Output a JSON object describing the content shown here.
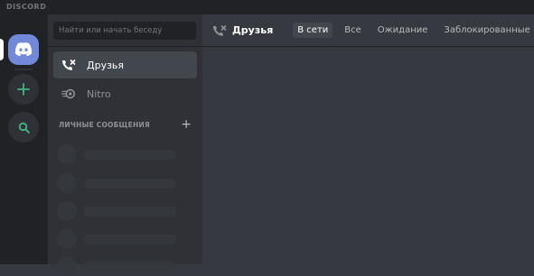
{
  "app": {
    "brand": "DISCORD"
  },
  "guilds": {
    "home_icon": "discord-logo-icon",
    "add_icon": "plus-icon",
    "search_icon": "magnifier-icon"
  },
  "sidebar": {
    "search_placeholder": "Найти или начать беседу",
    "nav": [
      {
        "label": "Друзья",
        "icon": "friends-icon",
        "active": true
      },
      {
        "label": "Nitro",
        "icon": "nitro-icon",
        "active": false
      }
    ],
    "dm_header": "ЛИЧНЫЕ СООБЩЕНИЯ",
    "dm_add": "+"
  },
  "topbar": {
    "title": "Друзья",
    "tabs": [
      {
        "label": "В сети",
        "active": true
      },
      {
        "label": "Все",
        "active": false
      },
      {
        "label": "Ожидание",
        "active": false
      },
      {
        "label": "Заблокированные",
        "active": false
      }
    ]
  },
  "colors": {
    "blurple": "#7289da",
    "green": "#43b581",
    "bg_primary": "#36393f",
    "bg_secondary": "#2f3136",
    "bg_tertiary": "#202225"
  }
}
